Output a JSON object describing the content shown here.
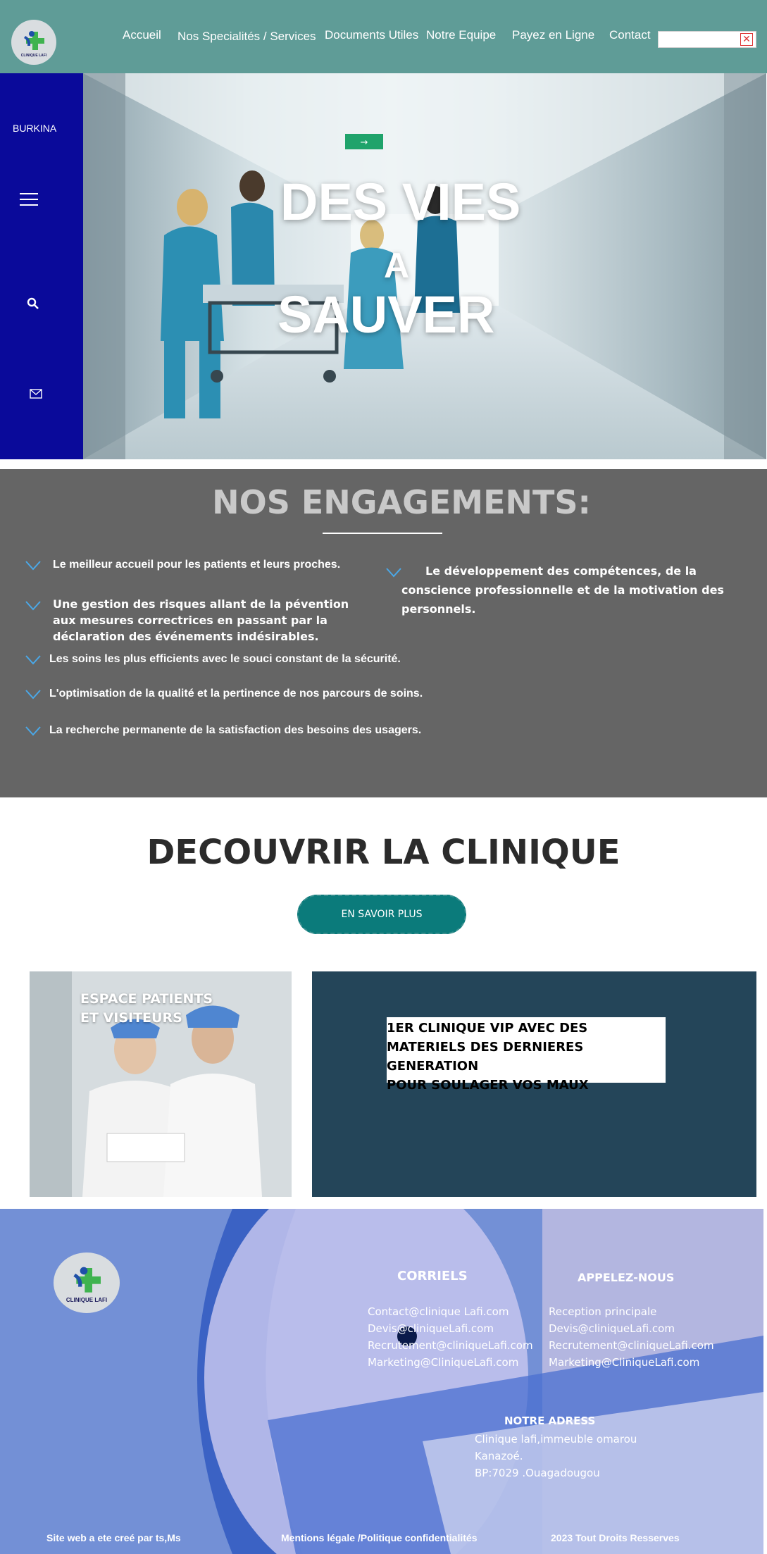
{
  "header": {
    "logo_text": "CLINIQUE LAFI",
    "nav": [
      {
        "label": "Accueil"
      },
      {
        "label": "Nos Specialités / Services"
      },
      {
        "label": "Documents Utiles"
      },
      {
        "label": "Notre Equipe"
      },
      {
        "label": "Payez en Ligne"
      },
      {
        "label": "Contact"
      }
    ],
    "search_value": ""
  },
  "hero": {
    "sidebar_label": "BURKINA",
    "exit_sign": "→",
    "title_line1": "DES VIES",
    "title_line2": "A",
    "title_line3": "SAUVER"
  },
  "engagements": {
    "title": "NOS ENGAGEMENTS:",
    "items": [
      "Le meilleur accueil pour les patients et leurs proches.",
      "Une gestion des risques allant de la pévention aux mesures correctrices en passant par la déclaration des événements indésirables.",
      "Les soins les plus efficients avec le souci constant de la sécurité.",
      "L'optimisation de la qualité et la pertinence de nos parcours de soins.",
      "La recherche permanente de la satisfaction des besoins des usagers.",
      "Le développement des compétences, de la conscience professionnelle et de la motivation des personnels."
    ]
  },
  "decouvrir": {
    "title": "DECOUVRIR  LA CLINIQUE",
    "button": "EN SAVOIR PLUS"
  },
  "espace": {
    "label": "ESPACE PATIENTS\nET VISITEURS"
  },
  "vip": {
    "text": "1ER CLINIQUE VIP AVEC DES\nMATERIELS DES DERNIERES GENERATION\nPOUR SOULAGER VOS MAUX"
  },
  "footer": {
    "logo_text": "CLINIQUE LAFI",
    "corriels_title": "CORRIELS",
    "corriels": [
      "Contact@clinique Lafi.com",
      "Devis@cliniqueLafi.com",
      "Recrutement@cliniqueLafi.com",
      "Marketing@CliniqueLafi.com"
    ],
    "appelez_title": "APPELEZ-NOUS",
    "appelez": [
      "Reception principale",
      "Devis@cliniqueLafi.com",
      "Recrutement@cliniqueLafi.com",
      "Marketing@CliniqueLafi.com"
    ],
    "adress_title": "NOTRE ADRESS",
    "adress": [
      "Clinique lafi,immeuble omarou",
      "Kanazoé.",
      "BP:7029 .Ouagadougou"
    ],
    "credit": "Site web a ete creé par ts,Ms",
    "mentions": "Mentions légale /Politique confidentialités",
    "rights": "2023 Tout Droits Resserves"
  },
  "colors": {
    "header_bg": "#5f9c97",
    "sidebar_bg": "#0a0a9a",
    "engagements_bg": "#656565",
    "button_bg": "#0b7b7b",
    "vip_bg": "#244559",
    "footer_bg": "#6f86c8"
  }
}
